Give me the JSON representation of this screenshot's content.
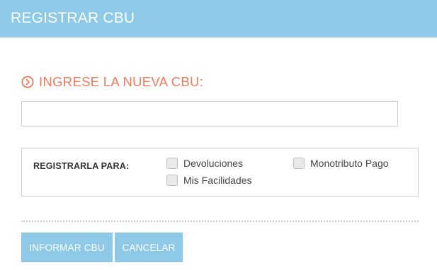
{
  "header": {
    "title": "REGISTRAR CBU"
  },
  "form": {
    "section_title": "INGRESE LA NUEVA CBU:",
    "cbu_input": {
      "value": "",
      "placeholder": ""
    },
    "register_for": {
      "label": "REGISTRARLA PARA:",
      "options": [
        {
          "label": "Devoluciones",
          "checked": false
        },
        {
          "label": "Mis Facilidades",
          "checked": false
        },
        {
          "label": "Monotributo Pago",
          "checked": false
        }
      ]
    }
  },
  "actions": {
    "informar_label": "INFORMAR CBU",
    "cancelar_label": "CANCELAR"
  },
  "colors": {
    "header_bg": "#8ecae8",
    "accent": "#f07a5b",
    "button_bg": "#8ecae8"
  }
}
